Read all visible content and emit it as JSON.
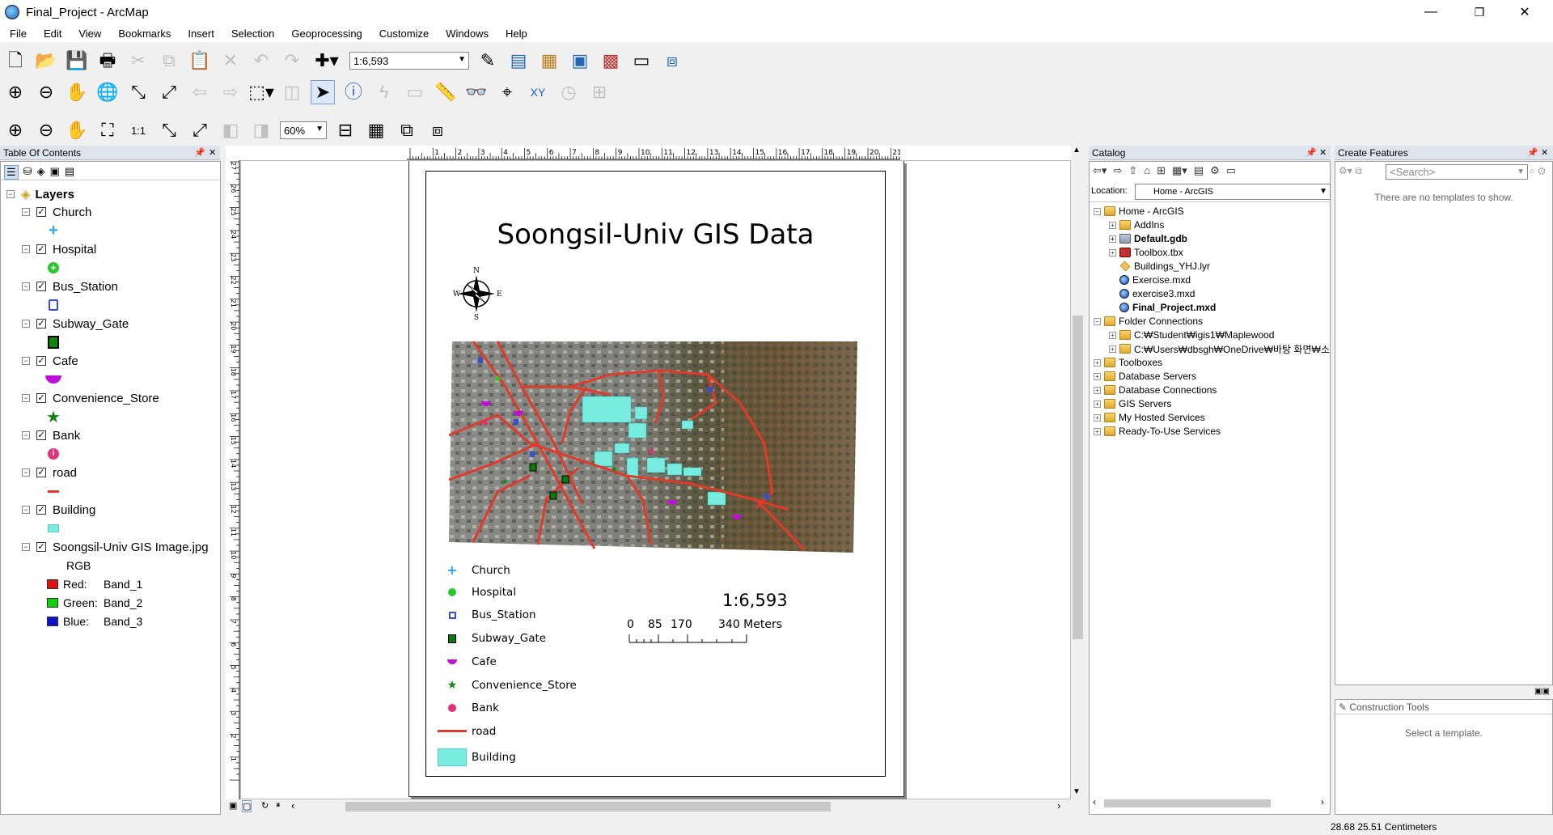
{
  "window": {
    "title": "Final_Project - ArcMap",
    "minimize": "—",
    "restore": "❐",
    "close": "✕"
  },
  "menu": [
    "File",
    "Edit",
    "View",
    "Bookmarks",
    "Insert",
    "Selection",
    "Geoprocessing",
    "Customize",
    "Windows",
    "Help"
  ],
  "toolbar": {
    "scale_value": "1:6,593",
    "zoom_percent": "60%"
  },
  "toc": {
    "header": "Table Of Contents",
    "root": "Layers",
    "layers": [
      {
        "name": "Church",
        "symbol": "plus-icon",
        "color": "#2aa9f0"
      },
      {
        "name": "Hospital",
        "symbol": "cross-circle-icon",
        "color": "#2ac82a"
      },
      {
        "name": "Bus_Station",
        "symbol": "bus-icon",
        "color": "#3a4fd0"
      },
      {
        "name": "Subway_Gate",
        "symbol": "train-icon",
        "color": "#0a8a0a"
      },
      {
        "name": "Cafe",
        "symbol": "semicircle-icon",
        "color": "#c010d8"
      },
      {
        "name": "Convenience_Store",
        "symbol": "star-icon",
        "color": "#118a11"
      },
      {
        "name": "Bank",
        "symbol": "info-circle-icon",
        "color": "#e0317a"
      },
      {
        "name": "road",
        "symbol": "line-icon",
        "color": "#e8352a"
      },
      {
        "name": "Building",
        "symbol": "fill-icon",
        "color": "#79ece0"
      },
      {
        "name": "Soongsil-Univ GIS Image.jpg",
        "symbol": "none",
        "color": ""
      }
    ],
    "raster": {
      "mode": "RGB",
      "bands": [
        {
          "channel": "Red:",
          "band": "Band_1",
          "color": "#e01010"
        },
        {
          "channel": "Green:",
          "band": "Band_2",
          "color": "#10d010"
        },
        {
          "channel": "Blue:",
          "band": "Band_3",
          "color": "#1010d0"
        }
      ]
    }
  },
  "layout": {
    "title": "Soongsil-Univ GIS Data",
    "north_letters": {
      "n": "N",
      "s": "S",
      "w": "W",
      "e": "E"
    },
    "legend": [
      {
        "label": "Church"
      },
      {
        "label": "Hospital"
      },
      {
        "label": "Bus_Station"
      },
      {
        "label": "Subway_Gate"
      },
      {
        "label": "Cafe"
      },
      {
        "label": "Convenience_Store"
      },
      {
        "label": "Bank"
      },
      {
        "label": "road"
      },
      {
        "label": "Building"
      }
    ],
    "scale_text": "1:6,593",
    "scalebar": {
      "t0": "0",
      "t1": "85",
      "t2": "170",
      "t3": "340 Meters"
    },
    "ruler_labels": [
      "1",
      "2",
      "3",
      "4",
      "5",
      "6",
      "7",
      "8",
      "9",
      "10",
      "11",
      "12",
      "13",
      "14",
      "15",
      "16",
      "17",
      "18",
      "19",
      "20",
      "21"
    ],
    "vruler_labels": [
      "27",
      "26",
      "25",
      "24",
      "23",
      "22",
      "21",
      "20",
      "19",
      "18",
      "17",
      "16",
      "15",
      "14",
      "13",
      "12",
      "11",
      "10",
      "9",
      "8",
      "7",
      "6",
      "5",
      "4",
      "3",
      "2",
      "1"
    ]
  },
  "catalog": {
    "header": "Catalog",
    "location_label": "Location:",
    "location_value": "Home - ArcGIS",
    "tree": [
      {
        "label": "Home - ArcGIS",
        "level": 0,
        "exp": "−",
        "icon": "folder",
        "bold": false
      },
      {
        "label": "AddIns",
        "level": 1,
        "exp": "+",
        "icon": "folder",
        "bold": false
      },
      {
        "label": "Default.gdb",
        "level": 1,
        "exp": "+",
        "icon": "gdb",
        "bold": true
      },
      {
        "label": "Toolbox.tbx",
        "level": 1,
        "exp": "+",
        "icon": "toolbox",
        "bold": false
      },
      {
        "label": "Buildings_YHJ.lyr",
        "level": 1,
        "exp": "",
        "icon": "lyr",
        "bold": false
      },
      {
        "label": "Exercise.mxd",
        "level": 1,
        "exp": "",
        "icon": "mxd",
        "bold": false
      },
      {
        "label": "exercise3.mxd",
        "level": 1,
        "exp": "",
        "icon": "mxd",
        "bold": false
      },
      {
        "label": "Final_Project.mxd",
        "level": 1,
        "exp": "",
        "icon": "mxd",
        "bold": true
      },
      {
        "label": "Folder Connections",
        "level": 0,
        "exp": "−",
        "icon": "folder",
        "bold": false
      },
      {
        "label": "C:₩Student₩igis1₩Maplewood",
        "level": 1,
        "exp": "+",
        "icon": "folder",
        "bold": false
      },
      {
        "label": "C:₩Users₩dbsgh₩OneDrive₩바탕 화면₩소",
        "level": 1,
        "exp": "+",
        "icon": "folder",
        "bold": false
      },
      {
        "label": "Toolboxes",
        "level": 0,
        "exp": "+",
        "icon": "folder",
        "bold": false
      },
      {
        "label": "Database Servers",
        "level": 0,
        "exp": "+",
        "icon": "folder",
        "bold": false
      },
      {
        "label": "Database Connections",
        "level": 0,
        "exp": "+",
        "icon": "folder",
        "bold": false
      },
      {
        "label": "GIS Servers",
        "level": 0,
        "exp": "+",
        "icon": "folder",
        "bold": false
      },
      {
        "label": "My Hosted Services",
        "level": 0,
        "exp": "+",
        "icon": "folder",
        "bold": false
      },
      {
        "label": "Ready-To-Use Services",
        "level": 0,
        "exp": "+",
        "icon": "folder",
        "bold": false
      }
    ]
  },
  "create_features": {
    "header": "Create Features",
    "search_placeholder": "<Search>",
    "empty_text": "There are no templates to show.",
    "construction_header": "Construction Tools",
    "construction_text": "Select a template."
  },
  "status": {
    "coords": "28.68  25.51 Centimeters"
  }
}
